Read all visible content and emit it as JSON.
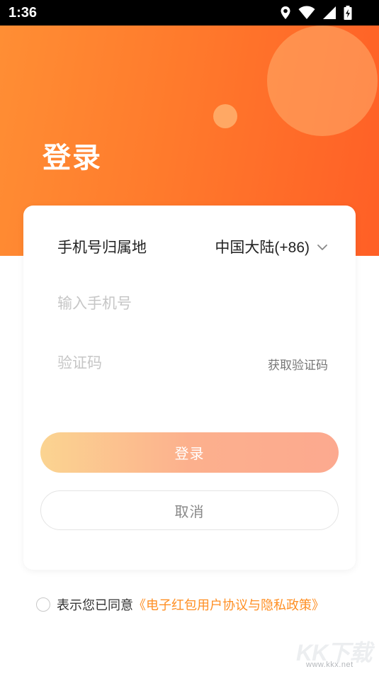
{
  "status_bar": {
    "time": "1:36",
    "icons": [
      "location-icon",
      "wifi-icon",
      "signal-icon",
      "battery-charging-icon"
    ]
  },
  "header": {
    "title": "登录"
  },
  "form": {
    "region_label": "手机号归属地",
    "region_value": "中国大陆(+86)",
    "phone_placeholder": "输入手机号",
    "phone_value": "",
    "code_placeholder": "验证码",
    "code_value": "",
    "get_code_label": "获取验证码",
    "login_label": "登录",
    "cancel_label": "取消"
  },
  "agreement": {
    "checked": false,
    "prefix": "表示您已同意",
    "link_text": "《电子红包用户协议与隐私政策》"
  },
  "watermark": {
    "logo": "KK下载",
    "url": "www.kkx.net"
  },
  "colors": {
    "hero_start": "#ff8e34",
    "hero_end": "#ff5f26",
    "login_button_start": "#fbd491",
    "login_button_end": "#fca98f",
    "link": "#ff8f24"
  }
}
